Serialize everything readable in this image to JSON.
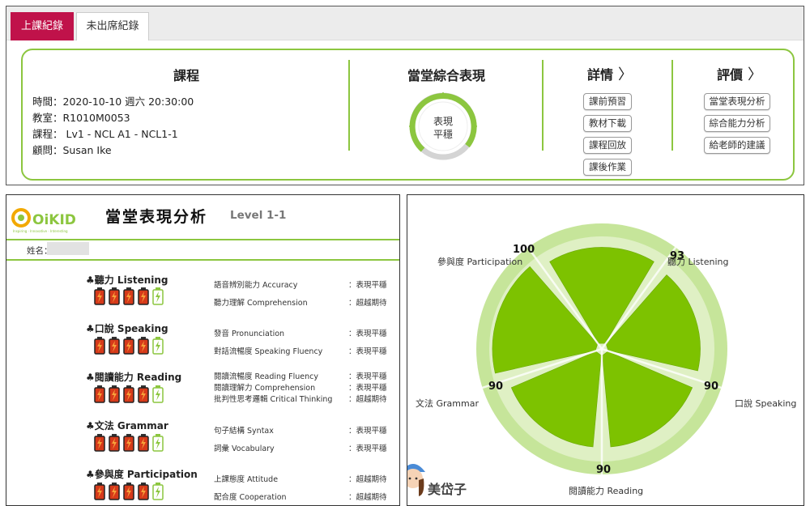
{
  "tabs": {
    "attended": "上課紀錄",
    "absent": "未出席紀錄"
  },
  "course": {
    "heading": "課程",
    "time": "時間：2020-10-10 週六 20:30:00",
    "classroom": "教室：R1010M0053",
    "lesson": "課程： Lv1 - NCL A1 - NCL1-1",
    "advisor": "顧問：Susan Ike"
  },
  "overall": {
    "heading": "當堂綜合表現",
    "gauge_line1": "表現",
    "gauge_line2": "平穩"
  },
  "details": {
    "heading": "詳情",
    "buttons": [
      "課前預習",
      "教材下載",
      "課程回放",
      "課後作業"
    ]
  },
  "evaluation": {
    "heading": "評價",
    "buttons": [
      "當堂表現分析",
      "綜合能力分析",
      "給老師的建議"
    ]
  },
  "report": {
    "logo_text": "OiKID",
    "title": "當堂表現分析",
    "level": "Level 1-1",
    "name_label": "姓名：",
    "skills": [
      {
        "name": "♣聽力 Listening",
        "subs": [
          {
            "label": "語音辨別能力 Accuracy",
            "result": "：表現平穩"
          },
          {
            "label": "聽力理解 Comprehension",
            "result": "：超越期待"
          }
        ]
      },
      {
        "name": "♣口說 Speaking",
        "subs": [
          {
            "label": "發音 Pronunciation",
            "result": "：表現平穩"
          },
          {
            "label": "對話流暢度 Speaking Fluency",
            "result": "：表現平穩"
          }
        ]
      },
      {
        "name": "♣閱讀能力 Reading",
        "subs": [
          {
            "label": "閱讀流暢度 Reading Fluency",
            "result": "：表現平穩"
          },
          {
            "label": "閱讀理解力 Comprehension",
            "result": "：表現平穩"
          },
          {
            "label": "批判性思考邏輯 Critical Thinking",
            "result": "：超越期待"
          }
        ]
      },
      {
        "name": "♣文法 Grammar",
        "subs": [
          {
            "label": "句子結構 Syntax",
            "result": "：表現平穩"
          },
          {
            "label": "詞彙 Vocabulary",
            "result": "：表現平穩"
          }
        ]
      },
      {
        "name": "♣參與度 Participation",
        "subs": [
          {
            "label": "上課態度 Attitude",
            "result": "：超越期待"
          },
          {
            "label": "配合度 Cooperation",
            "result": "：超越期待"
          }
        ]
      }
    ]
  },
  "radar": {
    "labels": [
      "聽力 Listening",
      "口說 Speaking",
      "閱讀能力 Reading",
      "文法 Grammar",
      "參與度 Participation"
    ],
    "values": [
      93,
      90,
      90,
      90,
      100
    ],
    "max": 100,
    "colors": {
      "fill": "#7dc200",
      "ring": "#c6e59a",
      "ring_light": "#dff0c4"
    }
  },
  "watermark": "美岱子"
}
